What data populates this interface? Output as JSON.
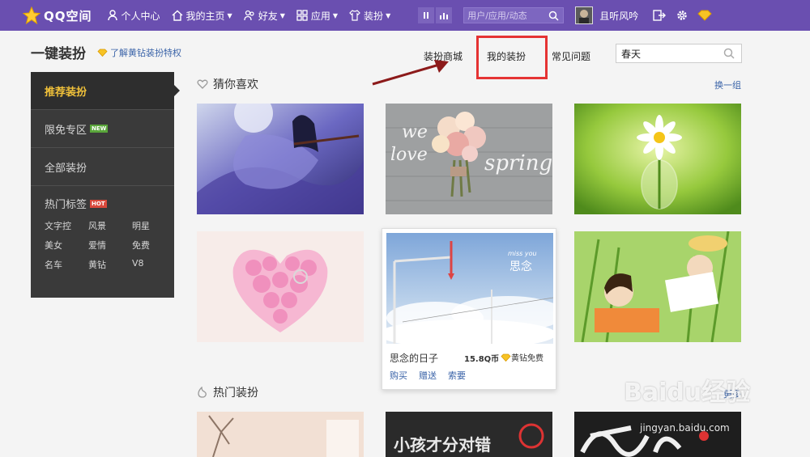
{
  "topbar": {
    "logo_text": "QQ空间",
    "nav": [
      {
        "label": "个人中心",
        "icon": "person-icon",
        "caret": false
      },
      {
        "label": "我的主页",
        "icon": "home-icon",
        "caret": true
      },
      {
        "label": "好友",
        "icon": "friends-icon",
        "caret": true
      },
      {
        "label": "应用",
        "icon": "apps-grid-icon",
        "caret": true
      },
      {
        "label": "装扮",
        "icon": "shirt-icon",
        "caret": true
      }
    ],
    "search_placeholder": "用户/应用/动态",
    "username": "且听风吟",
    "bg_color": "#6a4fb0"
  },
  "header": {
    "title": "一键装扮",
    "vip_link": "了解黄钻装扮特权",
    "tabs": [
      "装扮商城",
      "我的装扮",
      "常见问题"
    ],
    "search_value": "春天"
  },
  "sidebar": {
    "items": [
      {
        "label": "推荐装扮",
        "active": true
      },
      {
        "label": "限免专区",
        "badge": "NEW"
      },
      {
        "label": "全部装扮"
      }
    ],
    "hot_title": "热门标签",
    "hot_badge": "HOT",
    "tags": [
      "文字控",
      "风景",
      "明星",
      "美女",
      "爱情",
      "免费",
      "名车",
      "黄钻",
      "V8"
    ]
  },
  "main": {
    "section1_title": "猜你喜欢",
    "refresh_label": "换一组",
    "section2_title": "热门装扮",
    "more_label": "更多",
    "hover_card": {
      "name": "思念的日子",
      "price": "15.8Q币",
      "free_label": "黄钻免费",
      "actions": [
        "购买",
        "赠送",
        "索要"
      ]
    }
  },
  "images": {
    "flower_text_left": "we",
    "flower_text_left2": "love",
    "flower_text_right": "spring",
    "sky_text": "miss you",
    "sky_text2": "思念",
    "banner1_text": "小孩才分对错"
  },
  "watermark": {
    "main": "Baidu经验",
    "sub": "jingyan.baidu.com"
  }
}
